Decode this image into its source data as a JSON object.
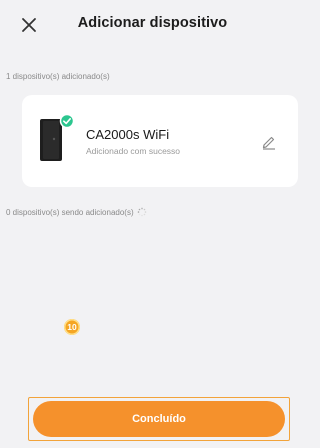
{
  "header": {
    "title": "Adicionar dispositivo"
  },
  "added_section": {
    "label": "1 dispositivo(s) adicionado(s)"
  },
  "device": {
    "name": "CA2000s WiFi",
    "status": "Adicionado com sucesso",
    "icon": "device-with-check-badge"
  },
  "adding_section": {
    "label": "0 dispositivo(s) sendo adicionado(s)"
  },
  "step_badge": {
    "value": "10"
  },
  "footer": {
    "done_label": "Concluído"
  },
  "colors": {
    "accent": "#f5912c",
    "success": "#2cc68f",
    "background": "#f2f2f4",
    "badge": "#f5a623"
  }
}
